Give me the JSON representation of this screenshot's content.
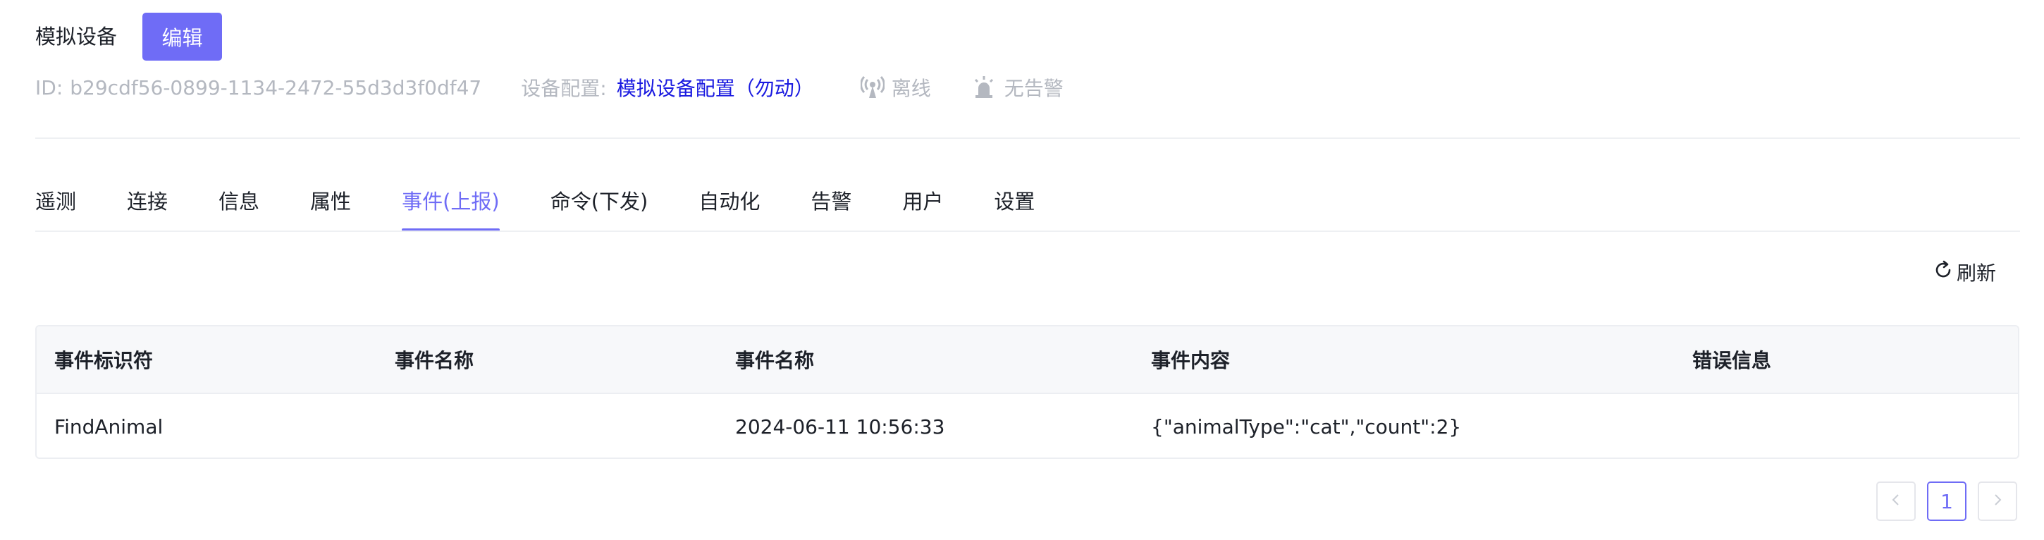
{
  "header": {
    "device_name": "模拟设备",
    "edit_label": "编辑",
    "id_label": "ID:",
    "id_value": "b29cdf56-0899-1134-2472-55d3d3f0df47",
    "config_label": "设备配置:",
    "config_value": "模拟设备配置（勿动）",
    "online_status": "离线",
    "alarm_status": "无告警"
  },
  "tabs": [
    {
      "label": "遥测"
    },
    {
      "label": "连接"
    },
    {
      "label": "信息"
    },
    {
      "label": "属性"
    },
    {
      "label": "事件(上报)",
      "active": true
    },
    {
      "label": "命令(下发)"
    },
    {
      "label": "自动化"
    },
    {
      "label": "告警"
    },
    {
      "label": "用户"
    },
    {
      "label": "设置"
    }
  ],
  "toolbar": {
    "refresh_label": "刷新"
  },
  "table": {
    "columns": [
      "事件标识符",
      "事件名称",
      "事件名称",
      "事件内容",
      "错误信息"
    ],
    "rows": [
      [
        "FindAnimal",
        "",
        "2024-06-11 10:56:33",
        "{\"animalType\":\"cat\",\"count\":2}",
        ""
      ]
    ]
  },
  "pagination": {
    "current_page": "1"
  },
  "colors": {
    "accent": "#6f6cf6",
    "link": "#1a1ae0",
    "muted": "#b4b8c0"
  }
}
